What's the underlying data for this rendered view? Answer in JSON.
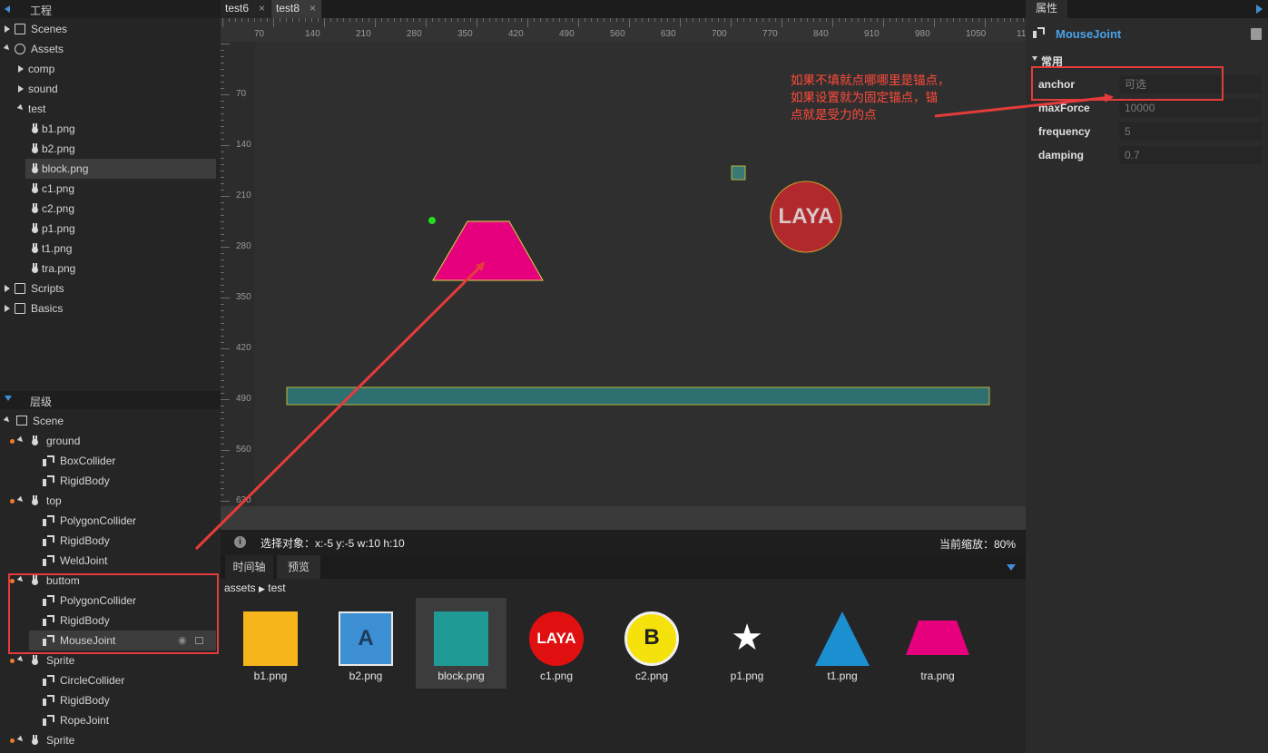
{
  "project": {
    "title": "工程",
    "items": [
      {
        "label": "Scenes"
      },
      {
        "label": "Assets"
      },
      {
        "label": "comp"
      },
      {
        "label": "sound"
      },
      {
        "label": "test"
      },
      {
        "label": "b1.png"
      },
      {
        "label": "b2.png"
      },
      {
        "label": "block.png"
      },
      {
        "label": "c1.png"
      },
      {
        "label": "c2.png"
      },
      {
        "label": "p1.png"
      },
      {
        "label": "t1.png"
      },
      {
        "label": "tra.png"
      },
      {
        "label": "Scripts"
      },
      {
        "label": "Basics"
      }
    ]
  },
  "hierarchy": {
    "title": "层级",
    "items": [
      {
        "label": "Scene"
      },
      {
        "label": "ground"
      },
      {
        "label": "BoxCollider"
      },
      {
        "label": "RigidBody"
      },
      {
        "label": "top"
      },
      {
        "label": "PolygonCollider"
      },
      {
        "label": "RigidBody"
      },
      {
        "label": "WeldJoint"
      },
      {
        "label": "buttom"
      },
      {
        "label": "PolygonCollider"
      },
      {
        "label": "RigidBody"
      },
      {
        "label": "MouseJoint"
      },
      {
        "label": "Sprite"
      },
      {
        "label": "CircleCollider"
      },
      {
        "label": "RigidBody"
      },
      {
        "label": "RopeJoint"
      },
      {
        "label": "Sprite"
      }
    ]
  },
  "tabs": [
    {
      "label": "test6",
      "close": "×"
    },
    {
      "label": "test8",
      "close": "×"
    }
  ],
  "ruler": {
    "h_ticks": [
      "70",
      "140",
      "210",
      "280",
      "350",
      "420",
      "490",
      "560",
      "630",
      "700",
      "770",
      "840",
      "910",
      "980",
      "1050",
      "11"
    ],
    "v_ticks": [
      "70",
      "140",
      "210",
      "280",
      "350",
      "420",
      "490",
      "560",
      "630"
    ]
  },
  "canvas": {
    "logo_text": "LAYA"
  },
  "status": {
    "selection": "选择对象：x:-5 y:-5  w:10 h:10",
    "zoom": "当前缩放：80%"
  },
  "bottom_tabs": [
    {
      "label": "时间轴"
    },
    {
      "label": "预览"
    }
  ],
  "breadcrumb": {
    "root": "assets",
    "sep": "▶",
    "leaf": "test"
  },
  "assets": [
    {
      "label": "b1.png",
      "text": ""
    },
    {
      "label": "b2.png",
      "text": "A"
    },
    {
      "label": "block.png",
      "text": ""
    },
    {
      "label": "c1.png",
      "text": "LAYA"
    },
    {
      "label": "c2.png",
      "text": "B"
    },
    {
      "label": "p1.png",
      "text": ""
    },
    {
      "label": "t1.png",
      "text": ""
    },
    {
      "label": "tra.png",
      "text": ""
    }
  ],
  "properties": {
    "tab": "属性",
    "component": "MouseJoint",
    "section": "常用",
    "rows": [
      {
        "label": "anchor",
        "value": "可选"
      },
      {
        "label": "maxForce",
        "value": "10000"
      },
      {
        "label": "frequency",
        "value": "5"
      },
      {
        "label": "damping",
        "value": "0.7"
      }
    ]
  },
  "annotation": {
    "line1": "如果不填就点哪哪里是锚点，",
    "line2": "如果设置就为固定锚点，锚",
    "line3": "点就是受力的点"
  },
  "colors": {
    "accent": "#3f8fd8",
    "annotation_red": "#e63b3b",
    "trapezoid": "#e6007e",
    "triangle": "#3a7390",
    "ground": "#2e7070",
    "circle": "#b1292c",
    "green_dot": "#22dd22"
  }
}
